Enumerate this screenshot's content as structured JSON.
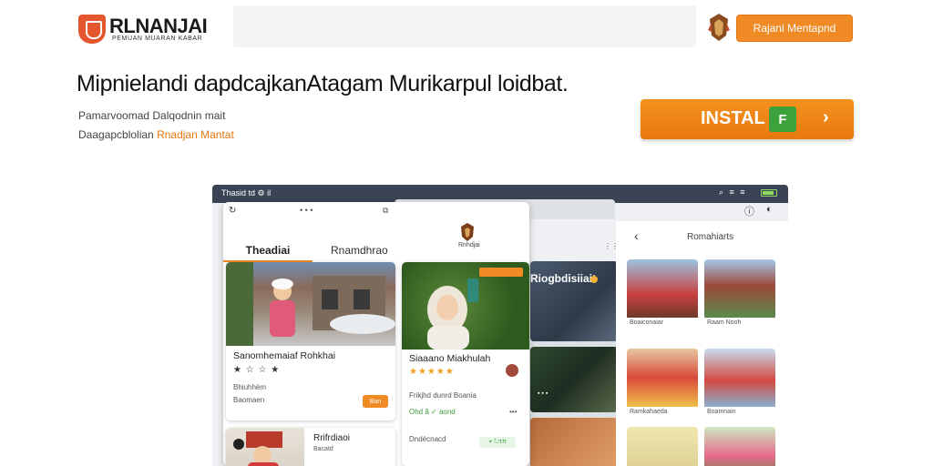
{
  "header": {
    "brand": "RLNANJAI",
    "brand_sub": "PEMUAN MUARAN KABAR",
    "cta_label": "Rajanl Mentapnd"
  },
  "hero": {
    "headline": "Mipnielandi dapdcajkanAtagam Murikarpul loidbat.",
    "sub1": "Pamarvoomad Dalqodnin mait",
    "sub2_prefix": "Daagapcblolian",
    "sub2_highlight": "Rnadjan Mantat",
    "install_label": "INSTAL",
    "install_icon": "F",
    "install_arrow": "›"
  },
  "device": {
    "status_left": "Thasid td ⚙ il",
    "status_right": "⌕ ≡ ≡",
    "url_icon": "↻",
    "url_dots": "• • •",
    "url_icon2": "⧉",
    "tabs": [
      "Theadiai",
      "Rnamdhrao"
    ],
    "tab_logo_label": "Rnhdjai",
    "cards": [
      {
        "title": "Sanomhemaiaf Rohkhai",
        "rating": "★ ☆ ☆ ★",
        "meta1": "Bhiuhhëm",
        "meta2": "Baomaen",
        "chip": "Ban"
      },
      {
        "title": "Siaaano Miakhulah",
        "rating": "★★★★★",
        "meta1": "Frikjhd dunrd Boania",
        "meta2": "Ohd ã ✓ aond",
        "chip": "•••",
        "meta3": "Dndécnacd",
        "bottom_btn": "⌖ ↻τπ"
      },
      {
        "title": "Rrifrdiaoi",
        "meta1": "Bacatd"
      }
    ],
    "mid_overlay": "Riogbdisiiait",
    "right_panel": {
      "back": "‹",
      "title": "Romahiarts",
      "icon1": "ⓘ",
      "icon2": "◐",
      "captions": [
        "Boaiconaiar",
        "Raam Nooh",
        "Ramkahaeda",
        "Boamnain",
        "",
        ""
      ]
    }
  },
  "colors": {
    "accent": "#f08a24",
    "status_bar": "#3a4455",
    "green": "#3ca23c"
  }
}
